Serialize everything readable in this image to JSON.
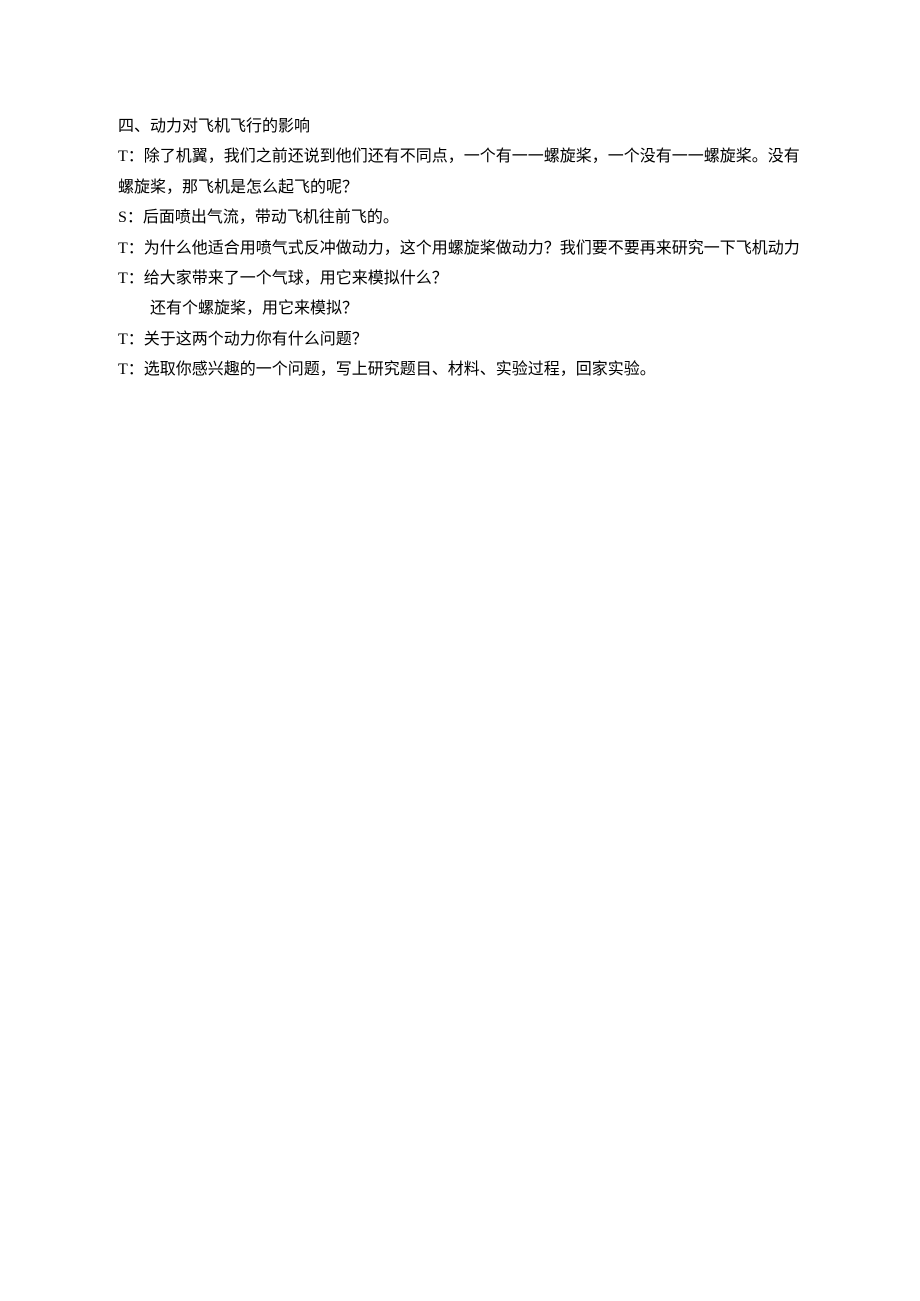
{
  "doc": {
    "heading": "四、动力对飞机飞行的影响",
    "lines": [
      "T：除了机翼，我们之前还说到他们还有不同点，一个有一一螺旋桨，一个没有一一螺旋桨。没有螺旋桨，那飞机是怎么起飞的呢？",
      "S：后面喷出气流，带动飞机往前飞的。",
      "T：为什么他适合用喷气式反冲做动力，这个用螺旋桨做动力？我们要不要再来研究一下飞机动力",
      "T：给大家带来了一个气球，用它来模拟什么？",
      "还有个螺旋桨，用它来模拟？",
      "T：关于这两个动力你有什么问题？",
      "T：选取你感兴趣的一个问题，写上研究题目、材料、实验过程，回家实验。"
    ]
  }
}
